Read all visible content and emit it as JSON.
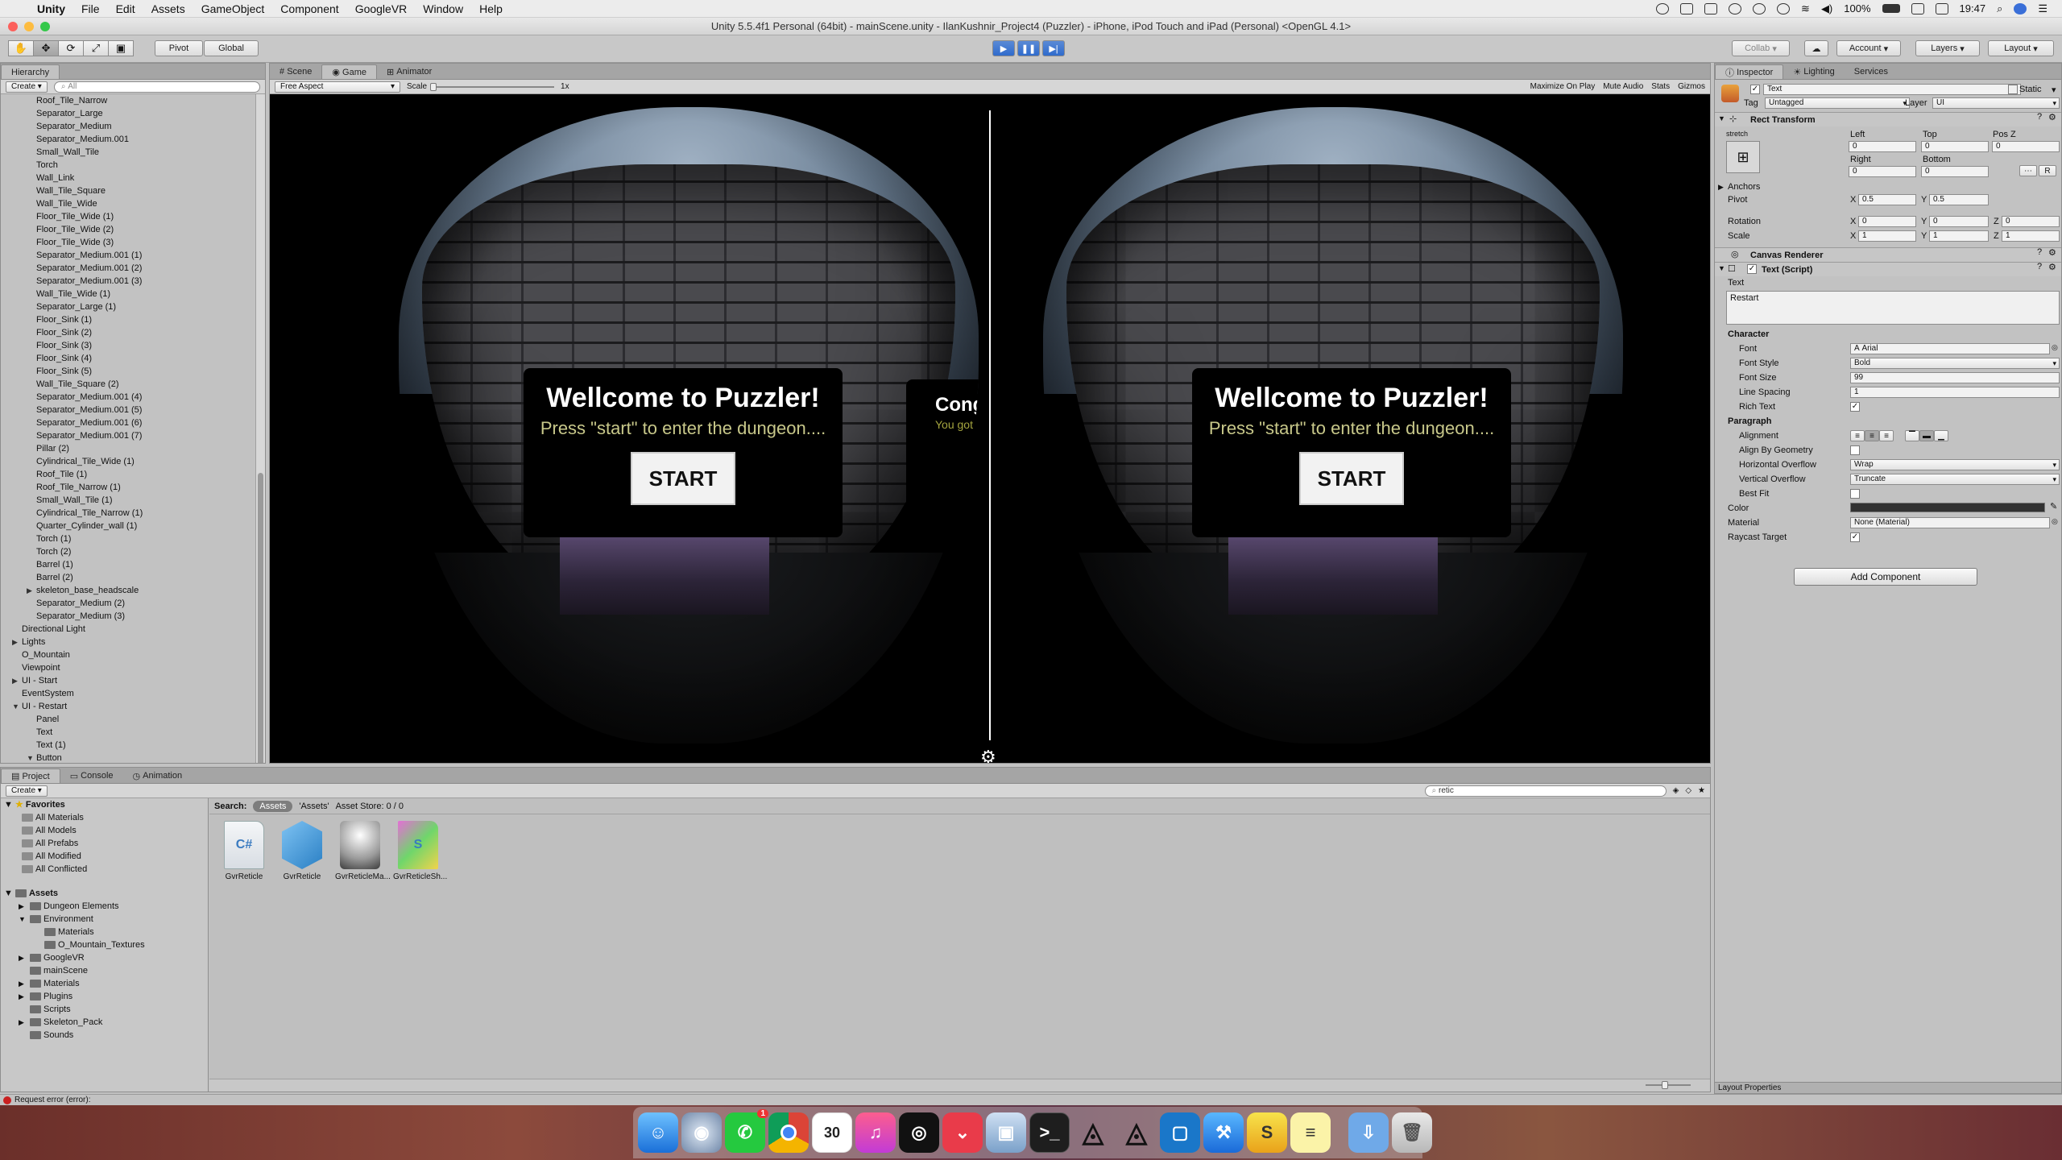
{
  "menubar": {
    "apple": "",
    "app": "Unity",
    "items": [
      "File",
      "Edit",
      "Assets",
      "GameObject",
      "Component",
      "GoogleVR",
      "Window",
      "Help"
    ],
    "battery": "100%",
    "time": "19:47"
  },
  "window": {
    "title": "Unity 5.5.4f1 Personal (64bit) - mainScene.unity - IlanKushnir_Project4 (Puzzler) - iPhone, iPod Touch and iPad (Personal) <OpenGL 4.1>"
  },
  "toolbar": {
    "pivot": "Pivot",
    "global": "Global",
    "collab": "Collab",
    "account": "Account",
    "layers": "Layers",
    "layout": "Layout"
  },
  "hierarchy": {
    "tab": "Hierarchy",
    "create": "Create",
    "search": "All",
    "items": [
      {
        "label": "Roof_Tile_Narrow",
        "indent": 2
      },
      {
        "label": "Separator_Large",
        "indent": 2
      },
      {
        "label": "Separator_Medium",
        "indent": 2
      },
      {
        "label": "Separator_Medium.001",
        "indent": 2
      },
      {
        "label": "Small_Wall_Tile",
        "indent": 2
      },
      {
        "label": "Torch",
        "indent": 2
      },
      {
        "label": "Wall_Link",
        "indent": 2
      },
      {
        "label": "Wall_Tile_Square",
        "indent": 2
      },
      {
        "label": "Wall_Tile_Wide",
        "indent": 2
      },
      {
        "label": "Floor_Tile_Wide (1)",
        "indent": 2
      },
      {
        "label": "Floor_Tile_Wide (2)",
        "indent": 2
      },
      {
        "label": "Floor_Tile_Wide (3)",
        "indent": 2
      },
      {
        "label": "Separator_Medium.001 (1)",
        "indent": 2
      },
      {
        "label": "Separator_Medium.001 (2)",
        "indent": 2
      },
      {
        "label": "Separator_Medium.001 (3)",
        "indent": 2
      },
      {
        "label": "Wall_Tile_Wide (1)",
        "indent": 2
      },
      {
        "label": "Separator_Large (1)",
        "indent": 2
      },
      {
        "label": "Floor_Sink (1)",
        "indent": 2
      },
      {
        "label": "Floor_Sink (2)",
        "indent": 2
      },
      {
        "label": "Floor_Sink (3)",
        "indent": 2
      },
      {
        "label": "Floor_Sink (4)",
        "indent": 2
      },
      {
        "label": "Floor_Sink (5)",
        "indent": 2
      },
      {
        "label": "Wall_Tile_Square (2)",
        "indent": 2
      },
      {
        "label": "Separator_Medium.001 (4)",
        "indent": 2
      },
      {
        "label": "Separator_Medium.001 (5)",
        "indent": 2
      },
      {
        "label": "Separator_Medium.001 (6)",
        "indent": 2
      },
      {
        "label": "Separator_Medium.001 (7)",
        "indent": 2
      },
      {
        "label": "Pillar (2)",
        "indent": 2
      },
      {
        "label": "Cylindrical_Tile_Wide (1)",
        "indent": 2
      },
      {
        "label": "Roof_Tile (1)",
        "indent": 2
      },
      {
        "label": "Roof_Tile_Narrow (1)",
        "indent": 2
      },
      {
        "label": "Small_Wall_Tile (1)",
        "indent": 2
      },
      {
        "label": "Cylindrical_Tile_Narrow (1)",
        "indent": 2
      },
      {
        "label": "Quarter_Cylinder_wall (1)",
        "indent": 2
      },
      {
        "label": "Torch (1)",
        "indent": 2
      },
      {
        "label": "Torch (2)",
        "indent": 2
      },
      {
        "label": "Barrel (1)",
        "indent": 2
      },
      {
        "label": "Barrel (2)",
        "indent": 2
      },
      {
        "label": "skeleton_base_headscale",
        "indent": 2,
        "arrow": "▶"
      },
      {
        "label": "Separator_Medium (2)",
        "indent": 2
      },
      {
        "label": "Separator_Medium (3)",
        "indent": 2
      },
      {
        "label": "Directional Light",
        "indent": 1
      },
      {
        "label": "Lights",
        "indent": 1,
        "arrow": "▶"
      },
      {
        "label": "O_Mountain",
        "indent": 1
      },
      {
        "label": "Viewpoint",
        "indent": 1
      },
      {
        "label": "UI - Start",
        "indent": 1,
        "arrow": "▶"
      },
      {
        "label": "EventSystem",
        "indent": 1
      },
      {
        "label": "UI - Restart",
        "indent": 1,
        "arrow": "▼"
      },
      {
        "label": "Panel",
        "indent": 2
      },
      {
        "label": "Text",
        "indent": 2
      },
      {
        "label": "Text (1)",
        "indent": 2
      },
      {
        "label": "Button",
        "indent": 2,
        "arrow": "▼"
      },
      {
        "label": "Text",
        "indent": 3,
        "selected": true
      }
    ]
  },
  "game": {
    "tabs": [
      "Scene",
      "Game",
      "Animator"
    ],
    "aspect": "Free Aspect",
    "scale_label": "Scale",
    "scale_value": "1x",
    "options": [
      "Maximize On Play",
      "Mute Audio",
      "Stats",
      "Gizmos"
    ],
    "card_title": "Wellcome to Puzzler!",
    "card_subtitle": "Press \"start\" to enter the dungeon....",
    "start_label": "START",
    "congrats_title": "Congr",
    "congrats_sub": "You got e"
  },
  "inspector": {
    "tabs": [
      "Inspector",
      "Lighting",
      "Services"
    ],
    "object_name": "Text",
    "static_label": "Static",
    "tag_label": "Tag",
    "tag_value": "Untagged",
    "layer_label": "Layer",
    "layer_value": "UI",
    "rect_transform": "Rect Transform",
    "stretch": "stretch",
    "left_label": "Left",
    "left_value": "0",
    "top_label": "Top",
    "top_value": "0",
    "posz_label": "Pos Z",
    "posz_value": "0",
    "right_label": "Right",
    "right_value": "0",
    "bottom_label": "Bottom",
    "bottom_value": "0",
    "r_button": "R",
    "anchors": "Anchors",
    "pivot_label": "Pivot",
    "pivot_x": "0.5",
    "pivot_y": "0.5",
    "rotation_label": "Rotation",
    "rot_x": "0",
    "rot_y": "0",
    "rot_z": "0",
    "scale_label": "Scale",
    "scale_x": "1",
    "scale_y": "1",
    "scale_z": "1",
    "canvas_renderer": "Canvas Renderer",
    "text_script": "Text (Script)",
    "text_label": "Text",
    "text_value": "Restart",
    "character": "Character",
    "font_label": "Font",
    "font_value": "Arial",
    "font_style_label": "Font Style",
    "font_style_value": "Bold",
    "font_size_label": "Font Size",
    "font_size_value": "99",
    "line_spacing_label": "Line Spacing",
    "line_spacing_value": "1",
    "rich_text_label": "Rich Text",
    "paragraph": "Paragraph",
    "alignment_label": "Alignment",
    "align_geom_label": "Align By Geometry",
    "h_overflow_label": "Horizontal Overflow",
    "h_overflow_value": "Wrap",
    "v_overflow_label": "Vertical Overflow",
    "v_overflow_value": "Truncate",
    "best_fit_label": "Best Fit",
    "color_label": "Color",
    "material_label": "Material",
    "material_value": "None (Material)",
    "raycast_label": "Raycast Target",
    "add_component": "Add Component",
    "layout_properties": "Layout Properties"
  },
  "project": {
    "tabs": [
      "Project",
      "Console",
      "Animation"
    ],
    "create": "Create",
    "search_value": "retic",
    "search_label": "Search:",
    "scope_assets": "Assets",
    "scope_assets_quoted": "'Assets'",
    "asset_store": "Asset Store: 0 / 0",
    "favorites_title": "Favorites",
    "favorites": [
      "All Materials",
      "All Models",
      "All Prefabs",
      "All Modified",
      "All Conflicted"
    ],
    "assets_title": "Assets",
    "tree": [
      {
        "label": "Dungeon Elements",
        "indent": 1,
        "arrow": "▶"
      },
      {
        "label": "Environment",
        "indent": 1,
        "arrow": "▼"
      },
      {
        "label": "Materials",
        "indent": 2
      },
      {
        "label": "O_Mountain_Textures",
        "indent": 2
      },
      {
        "label": "GoogleVR",
        "indent": 1,
        "arrow": "▶"
      },
      {
        "label": "mainScene",
        "indent": 1
      },
      {
        "label": "Materials",
        "indent": 1,
        "arrow": "▶"
      },
      {
        "label": "Plugins",
        "indent": 1,
        "arrow": "▶"
      },
      {
        "label": "Scripts",
        "indent": 1
      },
      {
        "label": "Skeleton_Pack",
        "indent": 1,
        "arrow": "▶"
      },
      {
        "label": "Sounds",
        "indent": 1
      }
    ],
    "assets": [
      {
        "label": "GvrReticle",
        "kind": "script"
      },
      {
        "label": "GvrReticle",
        "kind": "prefab"
      },
      {
        "label": "GvrReticleMa...",
        "kind": "material"
      },
      {
        "label": "GvrReticleSh...",
        "kind": "shader"
      }
    ]
  },
  "status": {
    "message": "Request error (error):"
  },
  "dock": {
    "calendar_day": "30",
    "whatsapp_badge": "1"
  },
  "colors": {
    "play_blue": "#2f6bcc",
    "selection": "#8aa3c7",
    "error_red": "#c92020"
  }
}
